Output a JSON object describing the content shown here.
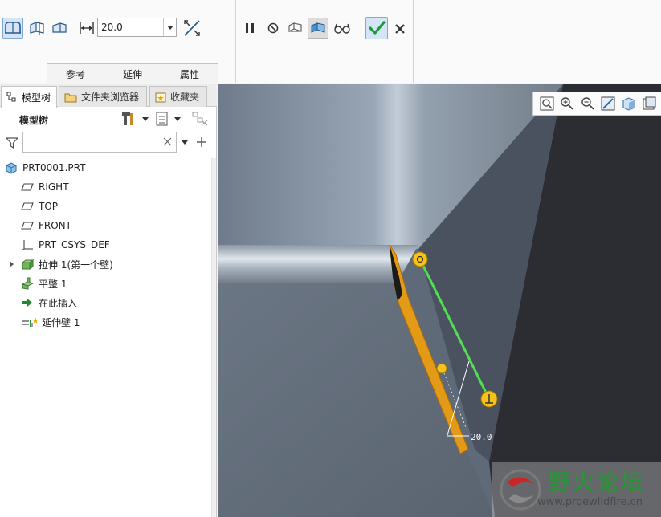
{
  "ribbon": {
    "depth_value": "20.0",
    "slide_tabs": [
      "参考",
      "延伸",
      "属性"
    ],
    "icons": {
      "wall_flat": "flat-wall-icon",
      "wall_up_to_plane": "up-to-plane-icon",
      "wall_to_edge": "to-edge-icon",
      "depth": "dimension-arrows-icon",
      "flip": "flip-direction-icon",
      "pause": "pause-icon",
      "no_preview": "no-preview-icon",
      "preview_attached": "preview-attached-icon",
      "preview_geometry": "preview-geometry-icon",
      "verify": "glasses-icon",
      "ok": "check-icon",
      "cancel": "close-icon"
    }
  },
  "left_panel": {
    "tabs": [
      {
        "label": "模型树",
        "icon": "model-tree-icon"
      },
      {
        "label": "文件夹浏览器",
        "icon": "folder-browser-icon"
      },
      {
        "label": "收藏夹",
        "icon": "favorites-icon"
      }
    ],
    "tree_title": "模型树",
    "search_placeholder": "",
    "tree_items": [
      {
        "label": "PRT0001.PRT",
        "icon": "part-icon"
      },
      {
        "label": "RIGHT",
        "icon": "datum-plane-icon"
      },
      {
        "label": "TOP",
        "icon": "datum-plane-icon"
      },
      {
        "label": "FRONT",
        "icon": "datum-plane-icon"
      },
      {
        "label": "PRT_CSYS_DEF",
        "icon": "coordinate-system-icon"
      },
      {
        "label": "拉伸 1(第一个壁)",
        "icon": "extrude-wall-icon"
      },
      {
        "label": "平整 1",
        "icon": "flat-wall-feature-icon"
      },
      {
        "label": "在此插入",
        "icon": "insert-here-arrow-icon"
      },
      {
        "label": "延伸壁 1",
        "icon": "extend-wall-icon"
      }
    ]
  },
  "viewport": {
    "dimension_text": "20.0",
    "watermark_title": "野火论坛",
    "watermark_url": "www.proewildfire.cn",
    "colors": {
      "preview_wall": "#e39a16",
      "edge_highlight": "#52e052",
      "handle": "#f6c21c"
    }
  }
}
